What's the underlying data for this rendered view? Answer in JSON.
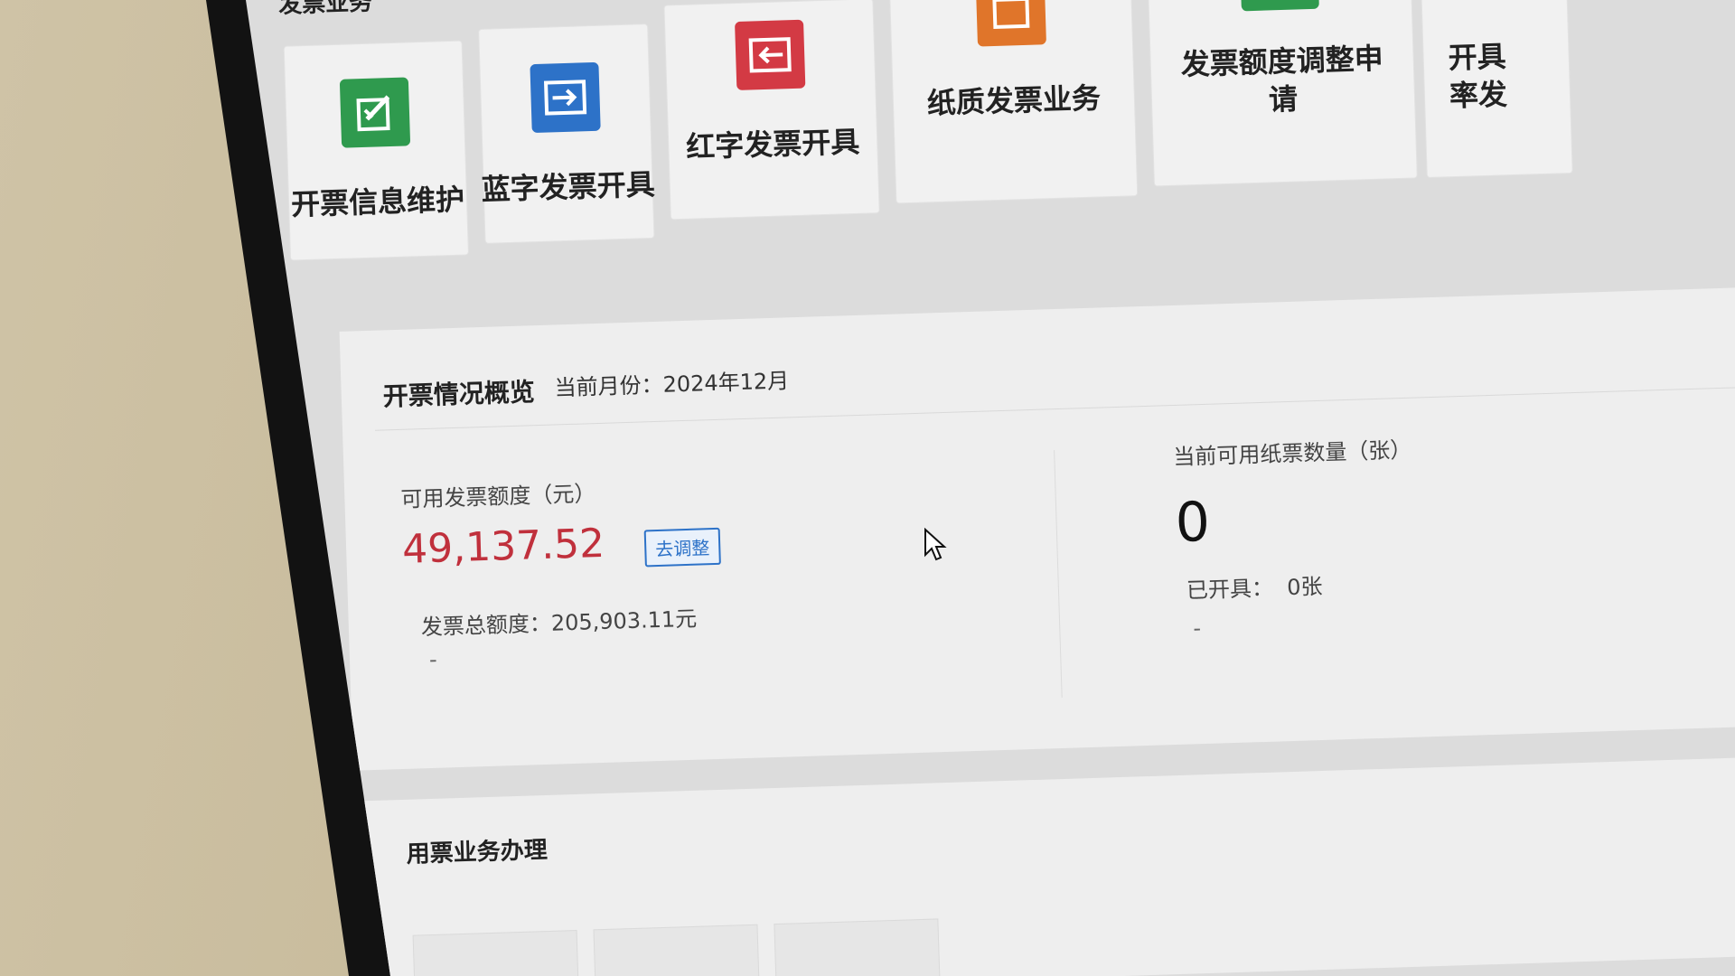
{
  "header": {
    "section_title": "发票业务"
  },
  "tiles": [
    {
      "label": "开票信息维护",
      "icon": "edit-document-icon",
      "color": "#2f9a4e"
    },
    {
      "label": "蓝字发票开具",
      "icon": "arrow-in-icon",
      "color": "#2d72c8"
    },
    {
      "label": "红字发票开具",
      "icon": "arrow-back-icon",
      "color": "#d33a44"
    },
    {
      "label": "纸质发票业务",
      "icon": "paper-invoice-icon",
      "color": "#e0752a"
    },
    {
      "label": "发票额度调整申请",
      "icon": "quota-edit-icon",
      "color": "#2f9a4e"
    },
    {
      "label": "开具率发",
      "icon": "more-icon"
    }
  ],
  "overview": {
    "title": "开票情况概览",
    "current_month": "当前月份：2024年12月",
    "available_quota_label": "可用发票额度（元）",
    "available_quota_value": "49,137.52",
    "adjust_button": "去调整",
    "total_quota": "发票总额度：205,903.11元",
    "paper_count_label": "当前可用纸票数量（张）",
    "paper_count_value": "0",
    "issued": "已开具：  0张",
    "dash": "-"
  },
  "business": {
    "title": "用票业务办理"
  },
  "colors": {
    "accent_blue": "#2d72c8",
    "red_value": "#c0303c",
    "green": "#2f9a4e",
    "orange": "#e0752a",
    "red_icon": "#d33a44"
  }
}
